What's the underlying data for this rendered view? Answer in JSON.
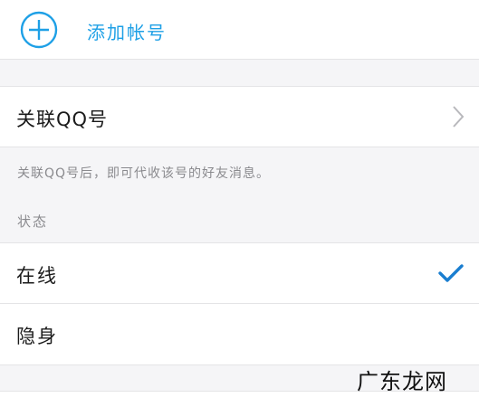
{
  "add_account": {
    "label": "添加帐号",
    "icon": "plus-circle-icon",
    "accent_color": "#1ea0e6"
  },
  "link_qq": {
    "label": "关联QQ号",
    "icon": "chevron-right-icon",
    "hint": "关联QQ号后，即可代收该号的好友消息。"
  },
  "status": {
    "title": "状态",
    "options": [
      {
        "label": "在线",
        "selected": true
      },
      {
        "label": "隐身",
        "selected": false
      }
    ],
    "check_icon": "checkmark-icon",
    "check_color": "#1a7ed0"
  },
  "watermark": "广东龙网"
}
